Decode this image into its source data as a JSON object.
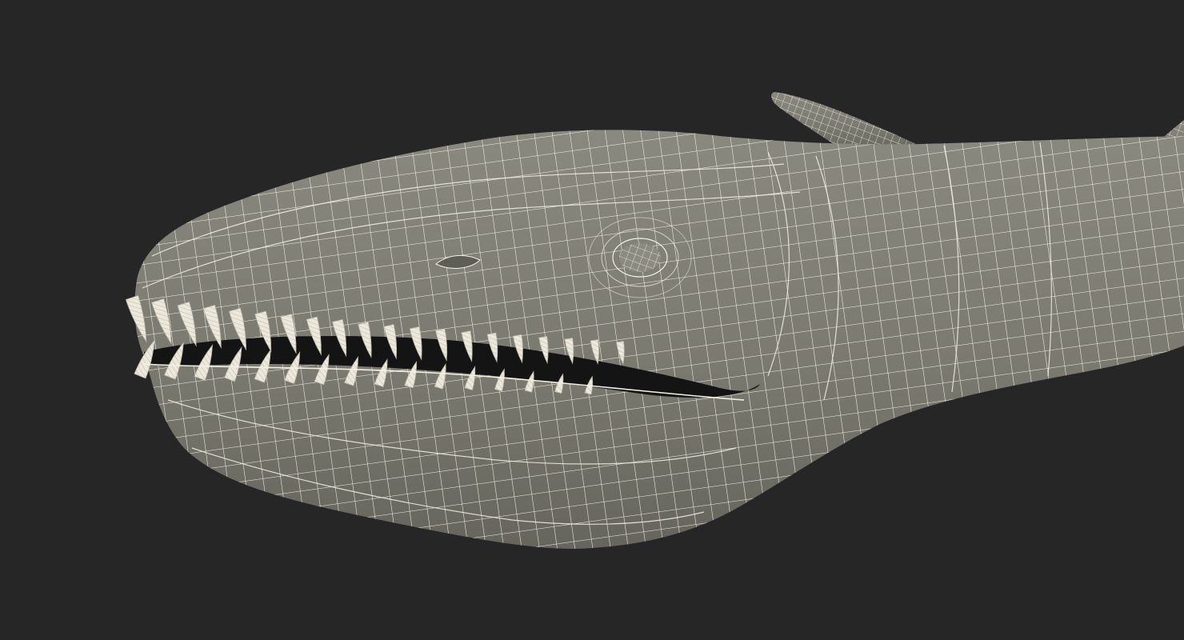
{
  "scene": {
    "subject": "wireframe-sea-monster-head",
    "colors": {
      "background": "#262626",
      "surface": "#7d7c72",
      "surface_shadow": "#5f5e56",
      "surface_light": "#95948a",
      "wire": "#f4f1e4",
      "teeth": "#ece9dc",
      "mouth": "#141414"
    }
  }
}
